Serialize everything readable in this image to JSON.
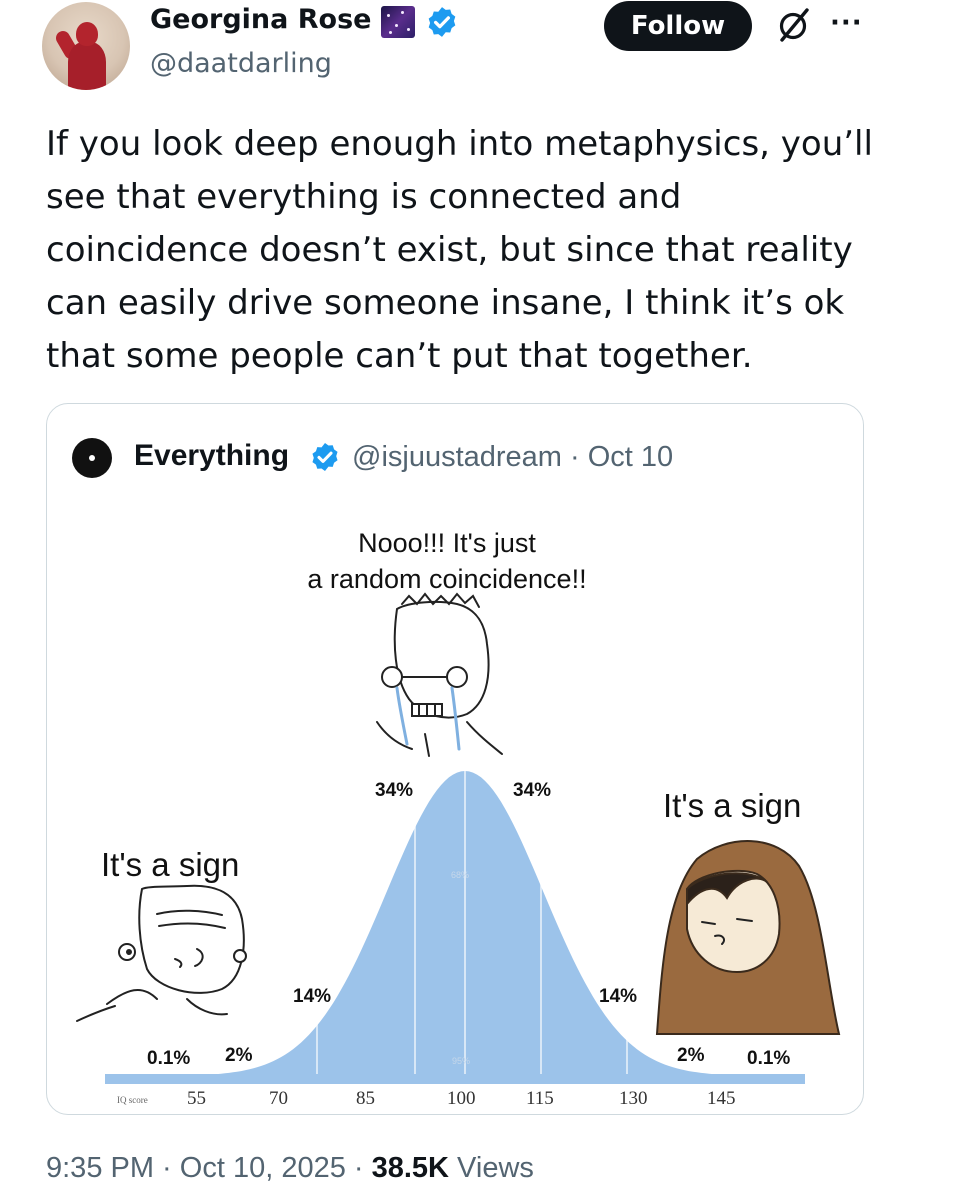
{
  "author": {
    "display_name": "Georgina Rose",
    "handle": "@daatdarling",
    "avatar_icon": "avatar-photo",
    "name_emoji": "milky-way-emoji",
    "verified_icon": "verified-badge-icon"
  },
  "actions": {
    "follow_label": "Follow",
    "grok_icon": "grok-icon",
    "more_label": "···"
  },
  "tweet": {
    "lines": [
      "If you look deep enough into metaphysics, you’ll",
      "see that everything is connected and",
      "coincidence doesn’t exist, but since that reality",
      "can easily drive someone insane, I think it’s ok",
      "that some people can’t put that together."
    ]
  },
  "quote": {
    "name": "Everything",
    "meta": "@isjuustadream · Oct 10",
    "meme": {
      "top_caption_1": "Nooo!!! It's just",
      "top_caption_2": "a random coincidence!!",
      "left_caption": "It's a sign",
      "right_caption": "It's a sign",
      "pct_left_outer": "0.1%",
      "pct_left_2": "2%",
      "pct_left_14": "14%",
      "pct_left_34": "34%",
      "pct_right_34": "34%",
      "pct_right_14": "14%",
      "pct_right_2": "2%",
      "pct_right_outer": "0.1%",
      "inner_68": "68%",
      "inner_95": "95%",
      "axis_label": "IQ score",
      "axis_ticks": [
        "55",
        "70",
        "85",
        "100",
        "115",
        "130",
        "145"
      ],
      "curve_color": "#9cc3ea"
    }
  },
  "footer": {
    "time": "9:35 PM · Oct 10, 2025 · ",
    "views_count": "38.5K",
    "views_label": " Views"
  }
}
